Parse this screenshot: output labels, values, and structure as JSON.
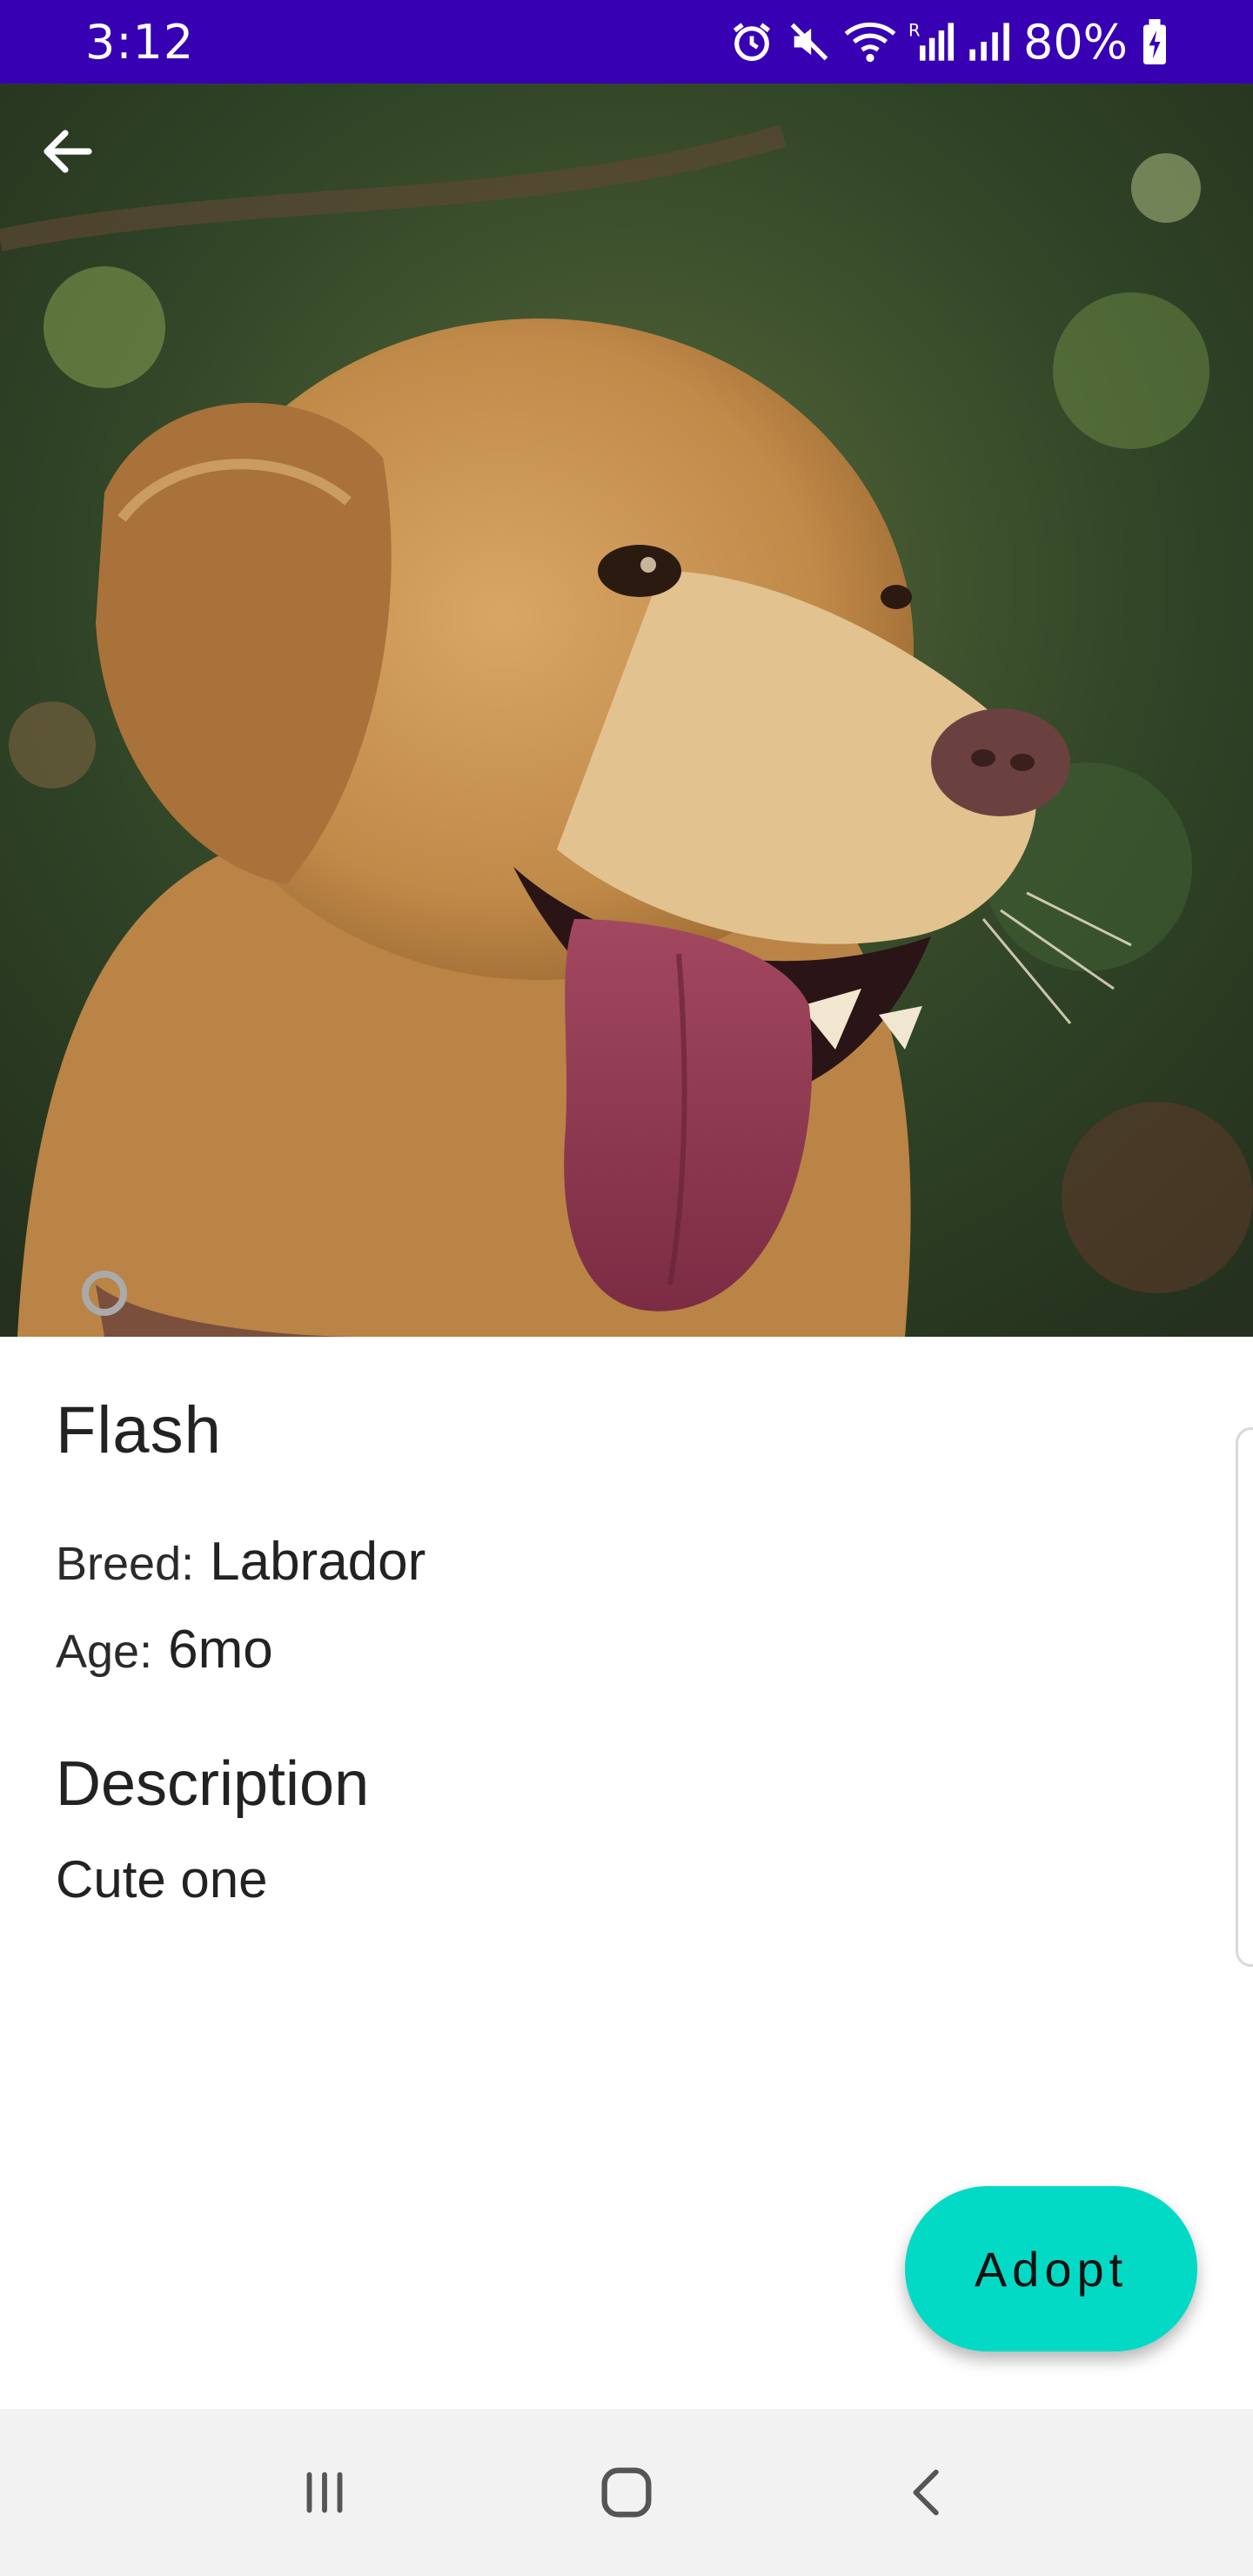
{
  "status_bar": {
    "time": "3:12",
    "battery": "80%",
    "icons": [
      "alarm-icon",
      "mute-icon",
      "wifi-icon",
      "roaming-signal-icon",
      "signal-icon",
      "battery-charging-icon"
    ]
  },
  "toolbar": {
    "back_icon": "arrow-back-icon"
  },
  "pet": {
    "name": "Flash",
    "breed_label": "Breed:",
    "breed": "Labrador",
    "age_label": "Age:",
    "age": "6mo",
    "description_title": "Description",
    "description": "Cute one"
  },
  "actions": {
    "adopt_label": "Adopt"
  },
  "nav_bar": {
    "icons": [
      "recent-apps-icon",
      "home-icon",
      "back-icon"
    ]
  },
  "colors": {
    "status_bar": "#3700b3",
    "accent": "#03dac5",
    "nav_bar": "#f2f2f2"
  }
}
